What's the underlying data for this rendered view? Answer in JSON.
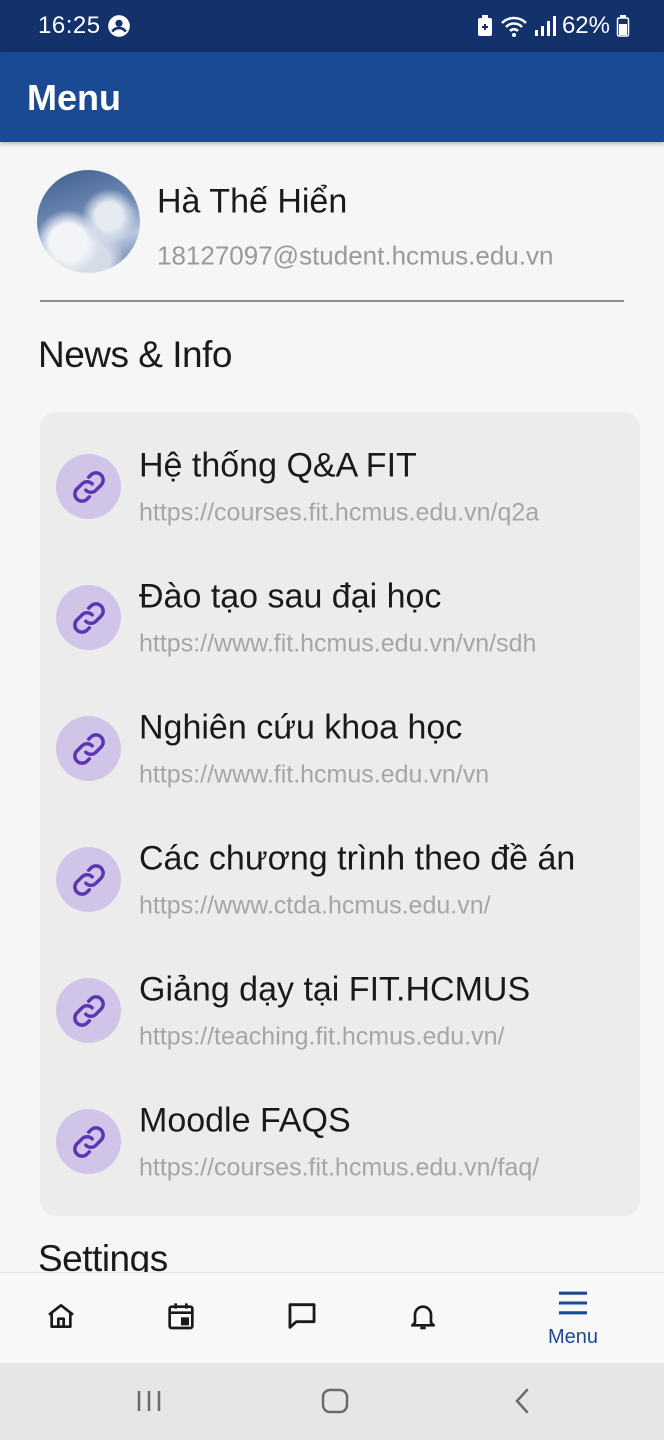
{
  "status_bar": {
    "time": "16:25",
    "battery": "62%",
    "left_icon": "account-circle-icon",
    "right_icons": [
      "battery-saver-icon",
      "wifi-icon",
      "signal-icon",
      "battery-icon"
    ]
  },
  "app_bar": {
    "title": "Menu"
  },
  "profile": {
    "name": "Hà Thế Hiển",
    "email": "18127097@student.hcmus.edu.vn"
  },
  "sections": {
    "news": "News & Info",
    "settings": "Settings"
  },
  "links": [
    {
      "title": "Hệ thống Q&A FIT",
      "url": "https://courses.fit.hcmus.edu.vn/q2a",
      "icon": "link-icon"
    },
    {
      "title": "Đào tạo sau đại học",
      "url": "https://www.fit.hcmus.edu.vn/vn/sdh",
      "icon": "link-icon"
    },
    {
      "title": "Nghiên cứu khoa học",
      "url": "https://www.fit.hcmus.edu.vn/vn",
      "icon": "link-icon"
    },
    {
      "title": "Các chương trình theo đề án",
      "url": "https://www.ctda.hcmus.edu.vn/",
      "icon": "link-icon"
    },
    {
      "title": "Giảng dạy tại FIT.HCMUS",
      "url": "https://teaching.fit.hcmus.edu.vn/",
      "icon": "link-icon"
    },
    {
      "title": "Moodle FAQS",
      "url": "https://courses.fit.hcmus.edu.vn/faq/",
      "icon": "link-icon"
    }
  ],
  "bottom_nav": {
    "items": [
      {
        "icon": "home-icon"
      },
      {
        "icon": "calendar-icon"
      },
      {
        "icon": "chat-icon"
      },
      {
        "icon": "bell-icon"
      },
      {
        "icon": "menu-icon",
        "label": "Menu",
        "selected": true
      }
    ]
  },
  "colors": {
    "status_bar": "#13316b",
    "app_bar": "#1b4a94",
    "accent": "#1b4a94",
    "link_icon_bg": "#d1c4e9",
    "link_icon_fg": "#5e35b1"
  }
}
